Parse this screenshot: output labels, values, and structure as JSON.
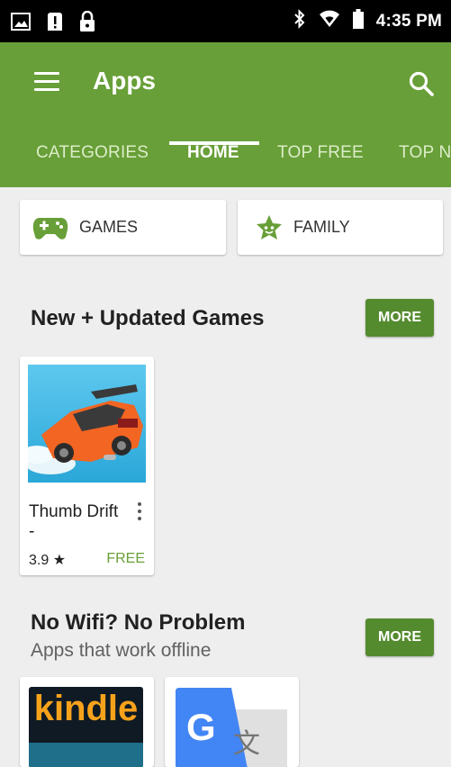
{
  "status_bar": {
    "time": "4:35 PM",
    "icons": [
      "image-icon",
      "alert-icon",
      "lock-icon",
      "bluetooth-icon",
      "wifi-icon",
      "battery-icon"
    ]
  },
  "app_bar": {
    "title": "Apps",
    "color": "#689f38"
  },
  "tabs": [
    {
      "label": "CATEGORIES",
      "active": false
    },
    {
      "label": "HOME",
      "active": true
    },
    {
      "label": "TOP FREE",
      "active": false
    },
    {
      "label": "TOP N",
      "active": false
    }
  ],
  "chips": [
    {
      "label": "GAMES",
      "icon": "gamepad-icon"
    },
    {
      "label": "FAMILY",
      "icon": "family-star-icon"
    }
  ],
  "sections": [
    {
      "title": "New + Updated Games",
      "more_label": "MORE",
      "apps": [
        {
          "name": "Thumb Drift -",
          "rating": "3.9 ★",
          "price": "FREE"
        }
      ]
    },
    {
      "title": "No Wifi? No Problem",
      "subtitle": "Apps that work offline",
      "more_label": "MORE",
      "apps": [
        {
          "name": "Kindle",
          "logo_text": "kindle"
        },
        {
          "name": "Google Translate",
          "logo_text": "G"
        }
      ]
    }
  ],
  "colors": {
    "accent": "#689f38",
    "button": "#558b2f",
    "background": "#eeeeee"
  }
}
